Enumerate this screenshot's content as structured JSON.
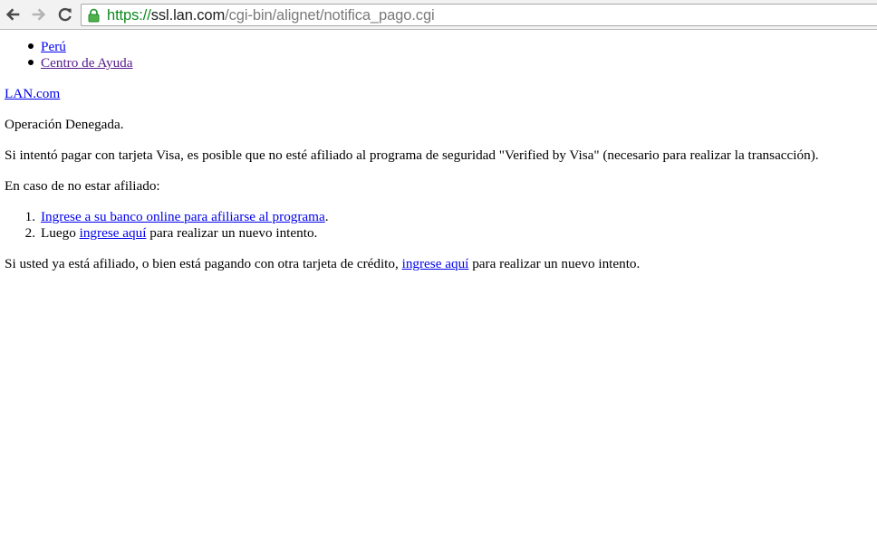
{
  "browser": {
    "url_scheme": "https://",
    "url_host": "ssl.lan.com",
    "url_path": "/cgi-bin/alignet/notifica_pago.cgi"
  },
  "nav_links": [
    "Perú",
    "Centro de Ayuda"
  ],
  "home_link": "LAN.com",
  "status": "Operación Denegada.",
  "visa_message": "Si intentó pagar con tarjeta Visa, es posible que no esté afiliado al programa de seguridad \"Verified by Visa\" (necesario para realizar la transacción).",
  "not_affiliated_intro": "En caso de no estar afiliado:",
  "steps": {
    "step1_number": "1.",
    "step1_link": "Ingrese a su banco online para afiliarse al programa",
    "step1_suffix": ".",
    "step2_number": "2.",
    "step2_prefix": "Luego",
    "step2_link": "ingrese aquí",
    "step2_suffix": "para realizar un nuevo intento."
  },
  "affiliated": {
    "prefix": "Si usted ya está afiliado, o bien está pagando con otra tarjeta de crédito,",
    "link": "ingrese aquí",
    "suffix": "para realizar un nuevo intento."
  }
}
